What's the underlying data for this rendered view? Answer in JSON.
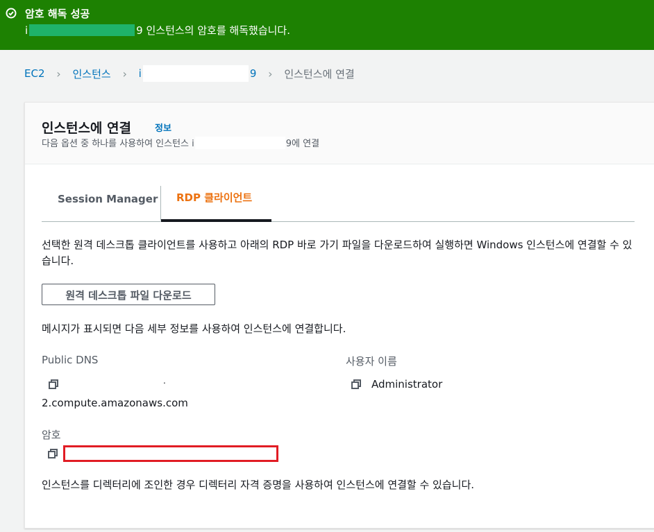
{
  "flash": {
    "title": "암호 해독 성공",
    "message_prefix": "i",
    "message_suffix": "9 인스턴스의 암호를 해독했습니다.",
    "color": "#1d8102",
    "icon": "check-circle-icon"
  },
  "breadcrumb": {
    "items": [
      "EC2",
      "인스턴스",
      "i",
      "9",
      "인스턴스에 연결"
    ],
    "separator_icon": "chevron-right-icon"
  },
  "panel": {
    "title": "인스턴스에 연결",
    "info_link": "정보",
    "description_prefix": "다음 옵션 중 하나를 사용하여 인스턴스 i",
    "description_suffix": "9에 연결"
  },
  "tabs": [
    {
      "label": "Session Manager",
      "selected": false
    },
    {
      "label": "RDP 클라이언트",
      "selected": true
    }
  ],
  "rdp": {
    "intro": "선택한 원격 데스크톱 클라이언트를 사용하고 아래의 RDP 바로 가기 파일을 다운로드하여 실행하면 Windows 인스턴스에 연결할 수 있습니다.",
    "download_button": "원격 데스크톱 파일 다운로드",
    "prompt_text": "메시지가 표시되면 다음 세부 정보를 사용하여 인스턴스에 연결합니다.",
    "public_dns_label": "Public DNS",
    "public_dns_value_top": ".",
    "public_dns_value": "2.compute.amazonaws.com",
    "username_label": "사용자 이름",
    "username_value": "Administrator",
    "password_label": "암호",
    "password_value": "",
    "directory_note": "인스턴스를 디렉터리에 조인한 경우 디렉터리 자격 증명을 사용하여 인스턴스에 연결할 수 있습니다.",
    "copy_icon": "copy-icon"
  },
  "colors": {
    "accent_link": "#0073bb",
    "tab_selected": "#ec7211",
    "highlight_box": "#e11c24"
  }
}
